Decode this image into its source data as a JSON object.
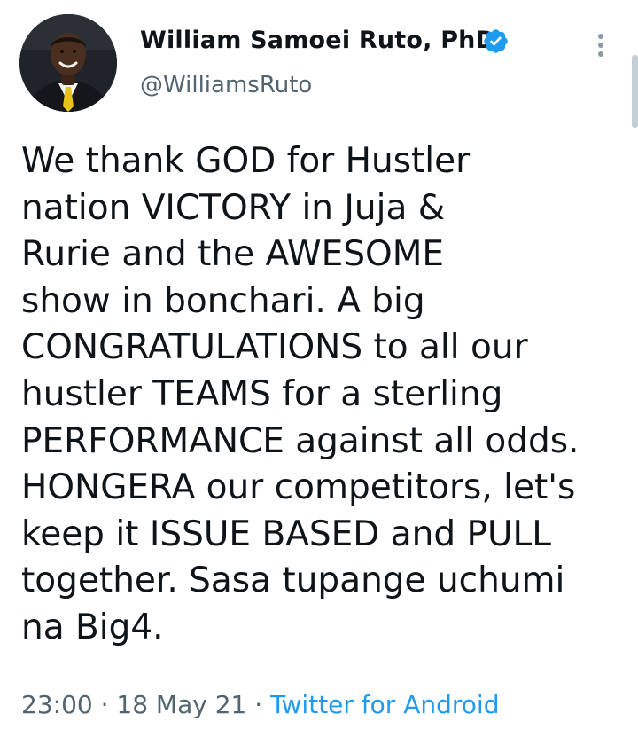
{
  "author": {
    "display_name": "William Samoei Ruto, PhD",
    "handle": "@WilliamsRuto",
    "verified": true
  },
  "icons": {
    "verified": "verified-badge-icon",
    "more": "more-vertical-icon",
    "avatar": "profile-photo"
  },
  "tweet": {
    "lines": [
      "We thank GOD for Hustler",
      "nation VICTORY in Juja &",
      "Rurie and the AWESOME",
      "show in bonchari. A big",
      "CONGRATULATIONS to all our",
      "hustler TEAMS for a sterling",
      "PERFORMANCE against all odds.",
      "HONGERA our competitors, let's",
      "keep it ISSUE BASED and PULL",
      "together. Sasa tupange uchumi",
      "na Big4."
    ]
  },
  "meta": {
    "time": "23:00",
    "separator": " · ",
    "date": "18 May 21",
    "source": "Twitter for Android"
  },
  "colors": {
    "text": "#0f1419",
    "secondary": "#536471",
    "link": "#1d9bf0",
    "verified": "#1d9bf0"
  }
}
